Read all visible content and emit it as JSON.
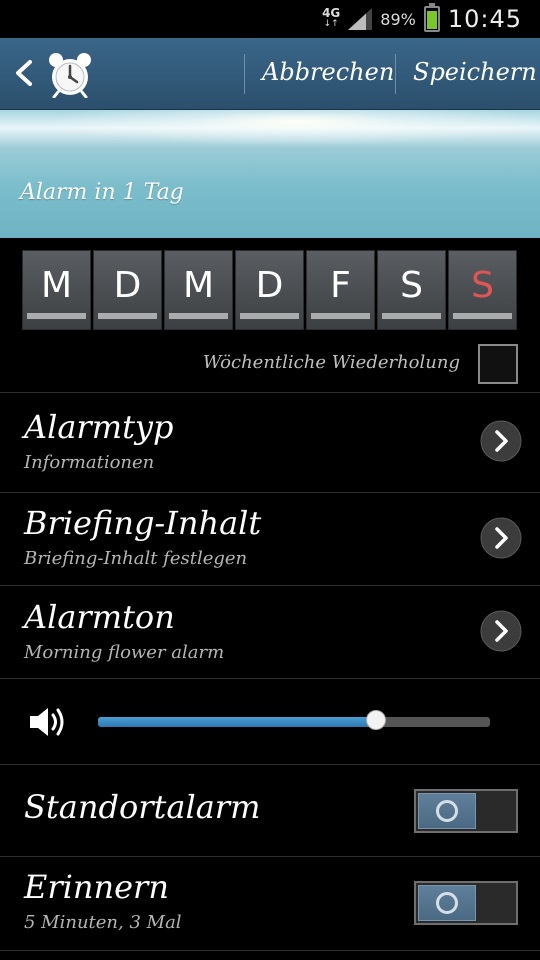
{
  "status": {
    "network": "4G",
    "battery_percent": "89%",
    "battery_level": 0.89,
    "time": "10:45",
    "colors": {
      "battery": "#7bc62d"
    }
  },
  "actionbar": {
    "back_icon": "chevron-left-icon",
    "app_icon": "alarm-clock-icon",
    "cancel_label": "Abbrechen",
    "save_label": "Speichern"
  },
  "banner": {
    "text": "Alarm in 1 Tag"
  },
  "days": [
    {
      "label": "M",
      "selected": false
    },
    {
      "label": "D",
      "selected": false
    },
    {
      "label": "M",
      "selected": false
    },
    {
      "label": "D",
      "selected": false
    },
    {
      "label": "F",
      "selected": false
    },
    {
      "label": "S",
      "selected": false
    },
    {
      "label": "S",
      "selected": false,
      "color": "#e25555"
    }
  ],
  "weekly_repeat": {
    "label": "Wöchentliche Wiederholung",
    "checked": false
  },
  "settings": [
    {
      "title": "Alarmtyp",
      "subtitle": "Informationen"
    },
    {
      "title": "Briefing-Inhalt",
      "subtitle": "Briefing-Inhalt festlegen"
    },
    {
      "title": "Alarmton",
      "subtitle": "Morning flower alarm"
    }
  ],
  "volume": {
    "icon": "speaker-icon",
    "level": 0.71
  },
  "toggles": [
    {
      "title": "Standortalarm",
      "subtitle": "",
      "on": false
    },
    {
      "title": "Erinnern",
      "subtitle": "5 Minuten, 3 Mal",
      "on": false
    }
  ]
}
